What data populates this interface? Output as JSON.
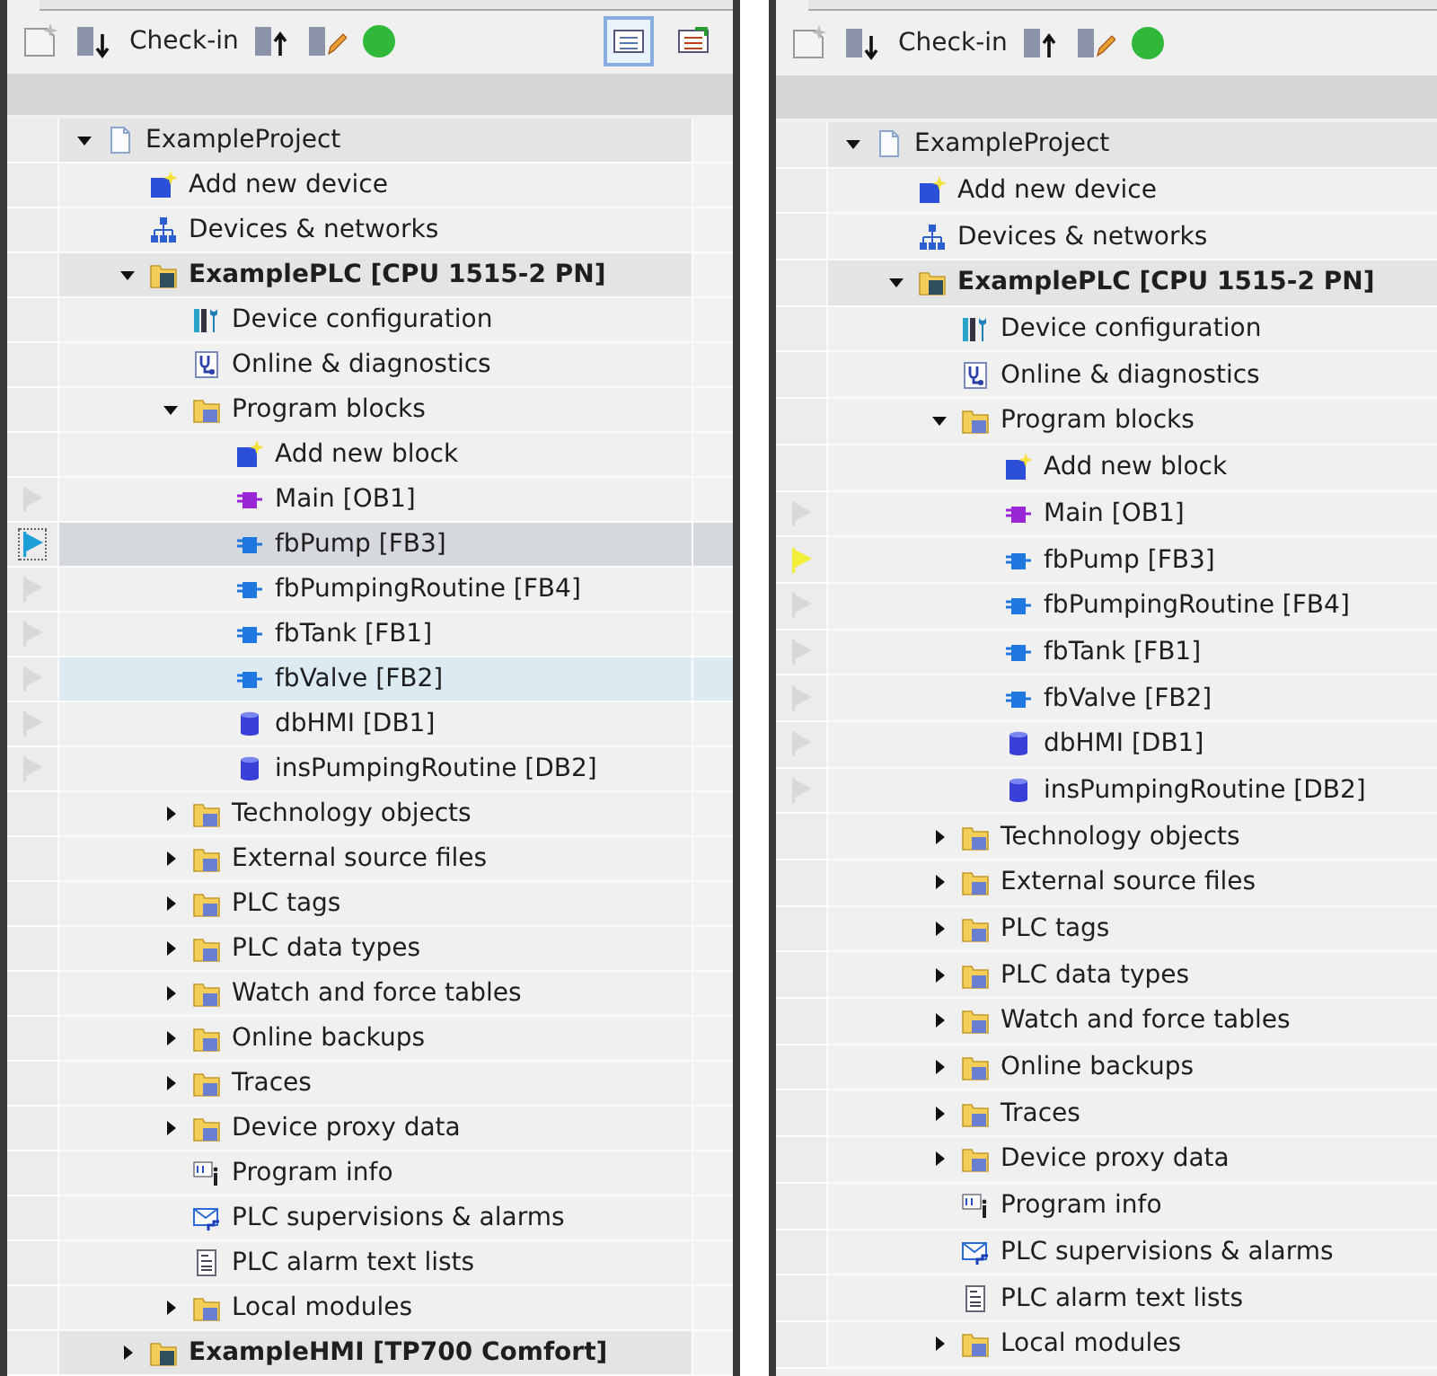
{
  "panels": [
    {
      "toolbar": {
        "check_in": "Check-in",
        "view_buttons": [
          {
            "selected": true
          },
          {
            "selected": false
          }
        ]
      },
      "tree": [
        {
          "label": "ExampleProject",
          "kind": "project",
          "expanded": true,
          "selected": false,
          "hovered": false,
          "children": [
            {
              "label": "Add new device",
              "kind": "add",
              "selected": false,
              "hovered": false
            },
            {
              "label": "Devices & networks",
              "kind": "network",
              "selected": false,
              "hovered": false
            },
            {
              "label": "ExamplePLC [CPU 1515-2 PN]",
              "kind": "plc",
              "expanded": true,
              "selected": false,
              "hovered": false,
              "children": [
                {
                  "label": "Device configuration",
                  "kind": "config",
                  "selected": false,
                  "hovered": false
                },
                {
                  "label": "Online & diagnostics",
                  "kind": "diag",
                  "selected": false,
                  "hovered": false
                },
                {
                  "label": "Program blocks",
                  "kind": "folder",
                  "expanded": true,
                  "selected": false,
                  "hovered": false,
                  "children": [
                    {
                      "label": "Add new block",
                      "kind": "add",
                      "selected": false,
                      "hovered": false
                    },
                    {
                      "label": "Main [OB1]",
                      "kind": "ob",
                      "color": "#d8d8d8",
                      "selected": false,
                      "hovered": false
                    },
                    {
                      "label": "fbPump [FB3]",
                      "kind": "fb",
                      "color": "#1e9ed8",
                      "selected": true,
                      "hovered": false
                    },
                    {
                      "label": "fbPumpingRoutine [FB4]",
                      "kind": "fb",
                      "color": "#d8d8d8",
                      "selected": false,
                      "hovered": false
                    },
                    {
                      "label": "fbTank [FB1]",
                      "kind": "fb",
                      "color": "#d8d8d8",
                      "selected": false,
                      "hovered": false
                    },
                    {
                      "label": "fbValve [FB2]",
                      "kind": "fb",
                      "color": "#d8d8d8",
                      "selected": false,
                      "hovered": true
                    },
                    {
                      "label": "dbHMI [DB1]",
                      "kind": "db",
                      "color": "#d8d8d8",
                      "selected": false,
                      "hovered": false
                    },
                    {
                      "label": "insPumpingRoutine [DB2]",
                      "kind": "db",
                      "color": "#d8d8d8",
                      "selected": false,
                      "hovered": false
                    }
                  ]
                },
                {
                  "label": "Technology objects",
                  "kind": "folder",
                  "expanded": false,
                  "selected": false,
                  "hovered": false
                },
                {
                  "label": "External source files",
                  "kind": "folder",
                  "expanded": false,
                  "selected": false,
                  "hovered": false
                },
                {
                  "label": "PLC tags",
                  "kind": "folder",
                  "expanded": false,
                  "selected": false,
                  "hovered": false
                },
                {
                  "label": "PLC data types",
                  "kind": "folder",
                  "expanded": false,
                  "selected": false,
                  "hovered": false
                },
                {
                  "label": "Watch and force tables",
                  "kind": "folder",
                  "expanded": false,
                  "selected": false,
                  "hovered": false
                },
                {
                  "label": "Online backups",
                  "kind": "folder",
                  "expanded": false,
                  "selected": false,
                  "hovered": false
                },
                {
                  "label": "Traces",
                  "kind": "folder",
                  "expanded": false,
                  "selected": false,
                  "hovered": false
                },
                {
                  "label": "Device proxy data",
                  "kind": "folder",
                  "expanded": false,
                  "selected": false,
                  "hovered": false
                },
                {
                  "label": "Program info",
                  "kind": "info",
                  "selected": false,
                  "hovered": false
                },
                {
                  "label": "PLC supervisions & alarms",
                  "kind": "alarms",
                  "selected": false,
                  "hovered": false
                },
                {
                  "label": "PLC alarm text lists",
                  "kind": "list",
                  "selected": false,
                  "hovered": false
                },
                {
                  "label": "Local modules",
                  "kind": "folder",
                  "expanded": false,
                  "selected": false,
                  "hovered": false
                }
              ]
            },
            {
              "label": "ExampleHMI [TP700 Comfort]",
              "kind": "plc",
              "expanded": false,
              "selected": false,
              "hovered": false
            }
          ]
        }
      ]
    },
    {
      "toolbar": {
        "check_in": "Check-in"
      },
      "tree": [
        {
          "label": "ExampleProject",
          "kind": "project",
          "expanded": true,
          "selected": false,
          "hovered": false,
          "children": [
            {
              "label": "Add new device",
              "kind": "add",
              "selected": false,
              "hovered": false
            },
            {
              "label": "Devices & networks",
              "kind": "network",
              "selected": false,
              "hovered": false
            },
            {
              "label": "ExamplePLC [CPU 1515-2 PN]",
              "kind": "plc",
              "expanded": true,
              "selected": false,
              "hovered": false,
              "children": [
                {
                  "label": "Device configuration",
                  "kind": "config",
                  "selected": false,
                  "hovered": false
                },
                {
                  "label": "Online & diagnostics",
                  "kind": "diag",
                  "selected": false,
                  "hovered": false
                },
                {
                  "label": "Program blocks",
                  "kind": "folder",
                  "expanded": true,
                  "selected": false,
                  "hovered": false,
                  "children": [
                    {
                      "label": "Add new block",
                      "kind": "add",
                      "selected": false,
                      "hovered": false
                    },
                    {
                      "label": "Main [OB1]",
                      "kind": "ob",
                      "color": "#d8d8d8",
                      "selected": false,
                      "hovered": false
                    },
                    {
                      "label": "fbPump [FB3]",
                      "kind": "fb",
                      "color": "#f2ee3a",
                      "selected": false,
                      "hovered": false
                    },
                    {
                      "label": "fbPumpingRoutine [FB4]",
                      "kind": "fb",
                      "color": "#d8d8d8",
                      "selected": false,
                      "hovered": false
                    },
                    {
                      "label": "fbTank [FB1]",
                      "kind": "fb",
                      "color": "#d8d8d8",
                      "selected": false,
                      "hovered": false
                    },
                    {
                      "label": "fbValve [FB2]",
                      "kind": "fb",
                      "color": "#d8d8d8",
                      "selected": false,
                      "hovered": false
                    },
                    {
                      "label": "dbHMI [DB1]",
                      "kind": "db",
                      "color": "#d8d8d8",
                      "selected": false,
                      "hovered": false
                    },
                    {
                      "label": "insPumpingRoutine [DB2]",
                      "kind": "db",
                      "color": "#d8d8d8",
                      "selected": false,
                      "hovered": false
                    }
                  ]
                },
                {
                  "label": "Technology objects",
                  "kind": "folder",
                  "expanded": false,
                  "selected": false,
                  "hovered": false
                },
                {
                  "label": "External source files",
                  "kind": "folder",
                  "expanded": false,
                  "selected": false,
                  "hovered": false
                },
                {
                  "label": "PLC tags",
                  "kind": "folder",
                  "expanded": false,
                  "selected": false,
                  "hovered": false
                },
                {
                  "label": "PLC data types",
                  "kind": "folder",
                  "expanded": false,
                  "selected": false,
                  "hovered": false
                },
                {
                  "label": "Watch and force tables",
                  "kind": "folder",
                  "expanded": false,
                  "selected": false,
                  "hovered": false
                },
                {
                  "label": "Online backups",
                  "kind": "folder",
                  "expanded": false,
                  "selected": false,
                  "hovered": false
                },
                {
                  "label": "Traces",
                  "kind": "folder",
                  "expanded": false,
                  "selected": false,
                  "hovered": false
                },
                {
                  "label": "Device proxy data",
                  "kind": "folder",
                  "expanded": false,
                  "selected": false,
                  "hovered": false
                },
                {
                  "label": "Program info",
                  "kind": "info",
                  "selected": false,
                  "hovered": false
                },
                {
                  "label": "PLC supervisions & alarms",
                  "kind": "alarms",
                  "selected": false,
                  "hovered": false
                },
                {
                  "label": "PLC alarm text lists",
                  "kind": "list",
                  "selected": false,
                  "hovered": false
                },
                {
                  "label": "Local modules",
                  "kind": "folder",
                  "expanded": false,
                  "selected": false,
                  "hovered": false
                }
              ]
            }
          ]
        }
      ]
    }
  ]
}
